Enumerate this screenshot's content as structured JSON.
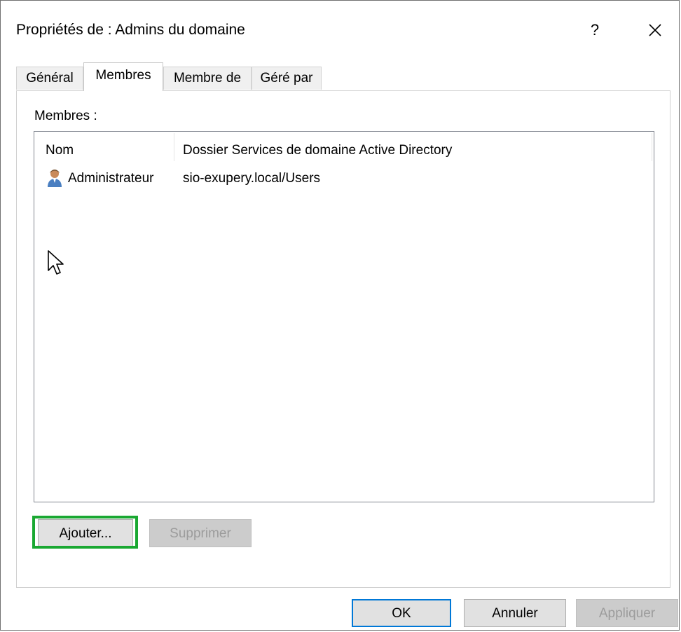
{
  "window": {
    "title": "Propriétés de : Admins du domaine",
    "help_label": "?",
    "close_label": "✕"
  },
  "tabs": [
    {
      "label": "Général",
      "active": false
    },
    {
      "label": "Membres",
      "active": true
    },
    {
      "label": "Membre de",
      "active": false
    },
    {
      "label": "Géré par",
      "active": false
    }
  ],
  "members": {
    "section_label": "Membres :",
    "columns": [
      "Nom",
      "Dossier Services de domaine Active Directory"
    ],
    "rows": [
      {
        "name": "Administrateur",
        "folder": "sio-exupery.local/Users",
        "icon": "user-icon"
      }
    ]
  },
  "actions": {
    "add_label": "Ajouter...",
    "remove_label": "Supprimer",
    "highlight_color": "#1aa832"
  },
  "footer": {
    "ok_label": "OK",
    "cancel_label": "Annuler",
    "apply_label": "Appliquer"
  },
  "colors": {
    "accent": "#0078d7"
  }
}
